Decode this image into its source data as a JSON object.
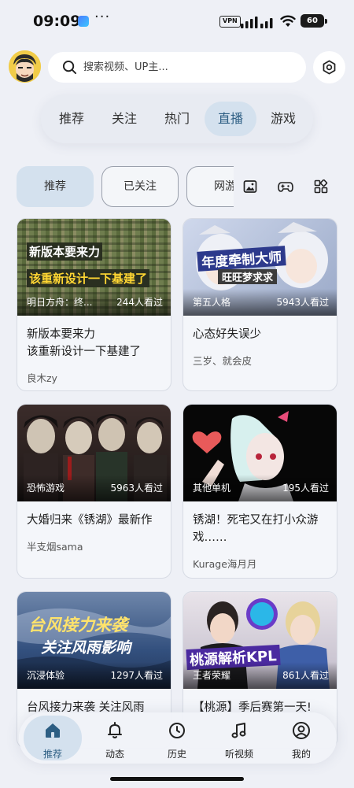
{
  "status_bar": {
    "time": "09:09",
    "more": "···",
    "vpn": "VPN",
    "battery": "60"
  },
  "search": {
    "placeholder": "搜索视频、UP主..."
  },
  "tabs": [
    "推荐",
    "关注",
    "热门",
    "直播",
    "游戏"
  ],
  "active_tab": "直播",
  "chips": [
    "推荐",
    "已关注",
    "网游"
  ],
  "active_chip": "推荐",
  "toolbar_icons": [
    "image-icon",
    "gamepad-icon",
    "apps-grid-icon"
  ],
  "cards": [
    {
      "category": "明日方舟：终...",
      "viewers": "244人看过",
      "title": "新版本要来力\n该重新设计一下基建了",
      "author": "良木zy",
      "caption1": "新版本要来力",
      "caption2": "该重新设计一下基建了"
    },
    {
      "category": "第五人格",
      "viewers": "5943人看过",
      "title": "心态好失误少",
      "author": "三岁、就会皮",
      "caption1": "年度牵制大师",
      "caption2": "旺旺梦求求"
    },
    {
      "category": "恐怖游戏",
      "viewers": "5963人看过",
      "title": "大婚归来《锈湖》最新作",
      "author": "半支烟sama"
    },
    {
      "category": "其他单机",
      "viewers": "195人看过",
      "title": "锈湖！死宅又在打小众游戏……",
      "author": "Kurage海月月"
    },
    {
      "category": "沉浸体验",
      "viewers": "1297人看过",
      "title": "台风接力来袭 关注风雨",
      "author": "",
      "caption1": "台风接力来袭",
      "caption2": "关注风雨影响"
    },
    {
      "category": "王者荣耀",
      "viewers": "861人看过",
      "title": "【桃源】季后赛第一天!",
      "author": "",
      "caption1": "桃源解析KPL"
    }
  ],
  "bottom_nav": [
    "推荐",
    "动态",
    "历史",
    "听视频",
    "我的"
  ],
  "active_nav": "推荐",
  "colors": {
    "accent": "#2d5e83",
    "active_bg": "#d4e1ee",
    "background": "#eef0f6"
  }
}
